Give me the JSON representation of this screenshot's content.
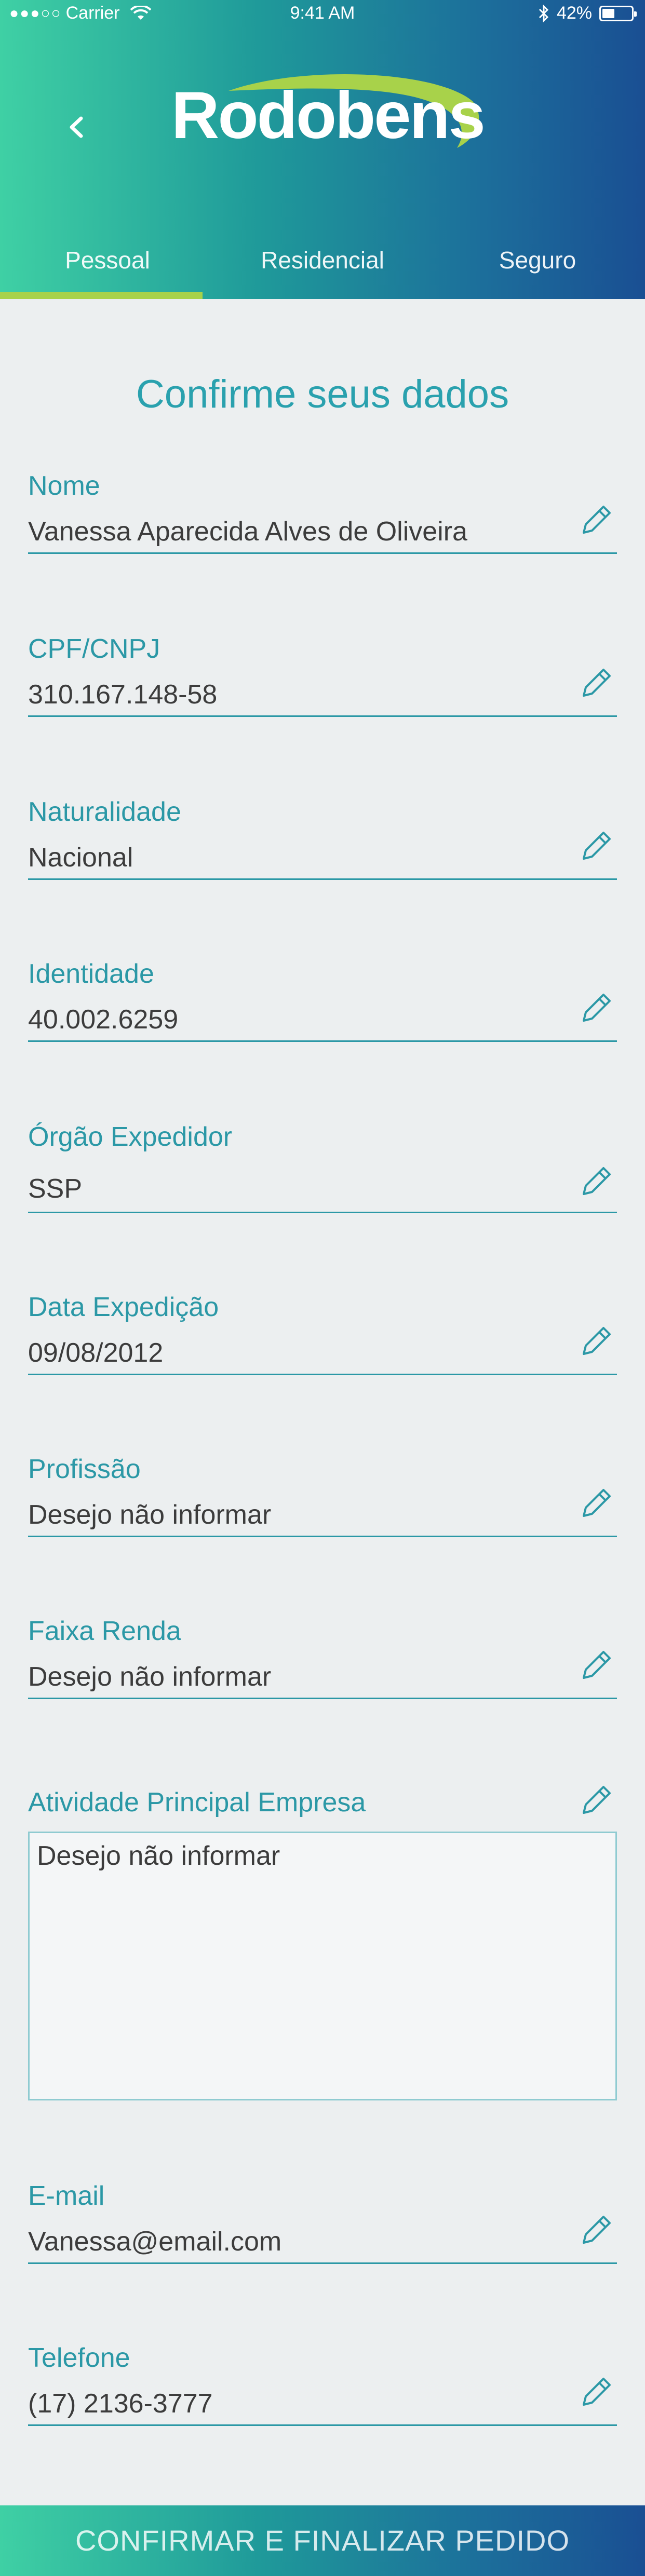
{
  "status_bar": {
    "signal": "●●●○○",
    "carrier": "Carrier",
    "time": "9:41 AM",
    "battery": "42%",
    "battery_level": 0.42
  },
  "header": {
    "logo": "Rodobens",
    "back_icon": "chevron-left-icon",
    "tabs": [
      {
        "label": "Pessoal",
        "active": true
      },
      {
        "label": "Residencial",
        "active": false
      },
      {
        "label": "Seguro",
        "active": false
      }
    ]
  },
  "page_title": "Confirme seus dados",
  "fields": [
    {
      "label": "Nome",
      "value": "Vanessa Aparecida Alves de Oliveira"
    },
    {
      "label": "CPF/CNPJ",
      "value": "310.167.148-58"
    },
    {
      "label": "Naturalidade",
      "value": "Nacional"
    },
    {
      "label": "Identidade",
      "value": "40.002.6259"
    },
    {
      "label": "Órgão Expedidor",
      "value": "SSP"
    },
    {
      "label": "Data Expedição",
      "value": "09/08/2012"
    },
    {
      "label": "Profissão",
      "value": "Desejo não informar"
    },
    {
      "label": "Faixa Renda",
      "value": "Desejo não informar"
    },
    {
      "label": "Atividade Principal Empresa",
      "value": "Desejo não informar"
    },
    {
      "label": "E-mail",
      "value": "Vanessa@email.com"
    },
    {
      "label": "Telefone",
      "value": "(17) 2136-3777"
    }
  ],
  "edit_icon": "pencil-icon",
  "footer": {
    "button_label": "CONFIRMAR E FINALIZAR PEDIDO"
  },
  "colors": {
    "accent": "#2b98a6",
    "tab_indicator": "#a8d24a",
    "gradient_start": "#3fd0a4",
    "gradient_end": "#1a4f93"
  }
}
